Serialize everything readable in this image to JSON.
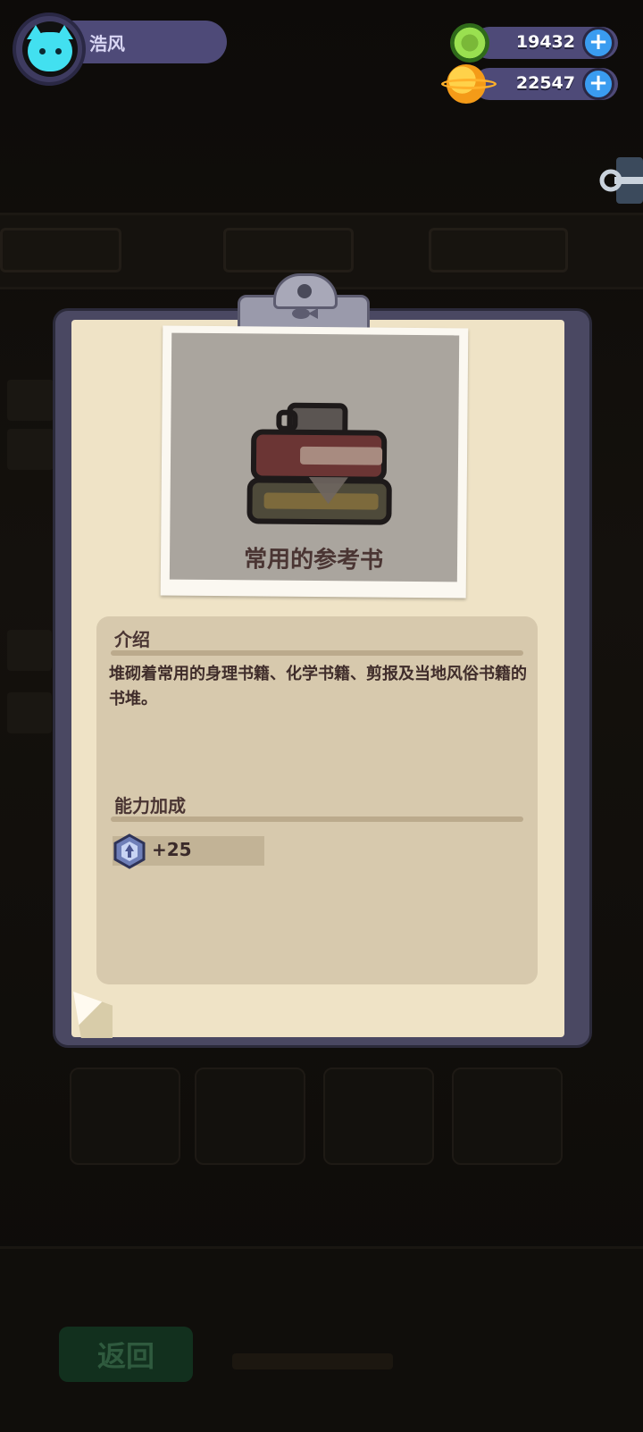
{
  "player": {
    "name": "浩风"
  },
  "currencies": [
    {
      "icon": "green-gem-coin-icon",
      "value": "19432",
      "plus": "+"
    },
    {
      "icon": "planet-coin-icon",
      "value": "22547",
      "plus": "+"
    }
  ],
  "item": {
    "name": "常用的参考书",
    "icon": "book-stack-icon"
  },
  "intro": {
    "title": "介绍",
    "text": "堆砌着常用的身理书籍、化学书籍、剪报及当地风俗书籍的书堆。"
  },
  "ability": {
    "title": "能力加成",
    "icon": "shield-bonus-icon",
    "value": "+25"
  },
  "background": {
    "back_button": "返回"
  },
  "colors": {
    "paper": "#efe3c6",
    "panel": "#d7c9ad",
    "header_bar": "#4e4a78",
    "plus_button": "#3a9cf0",
    "text_dark": "#4a3533"
  }
}
